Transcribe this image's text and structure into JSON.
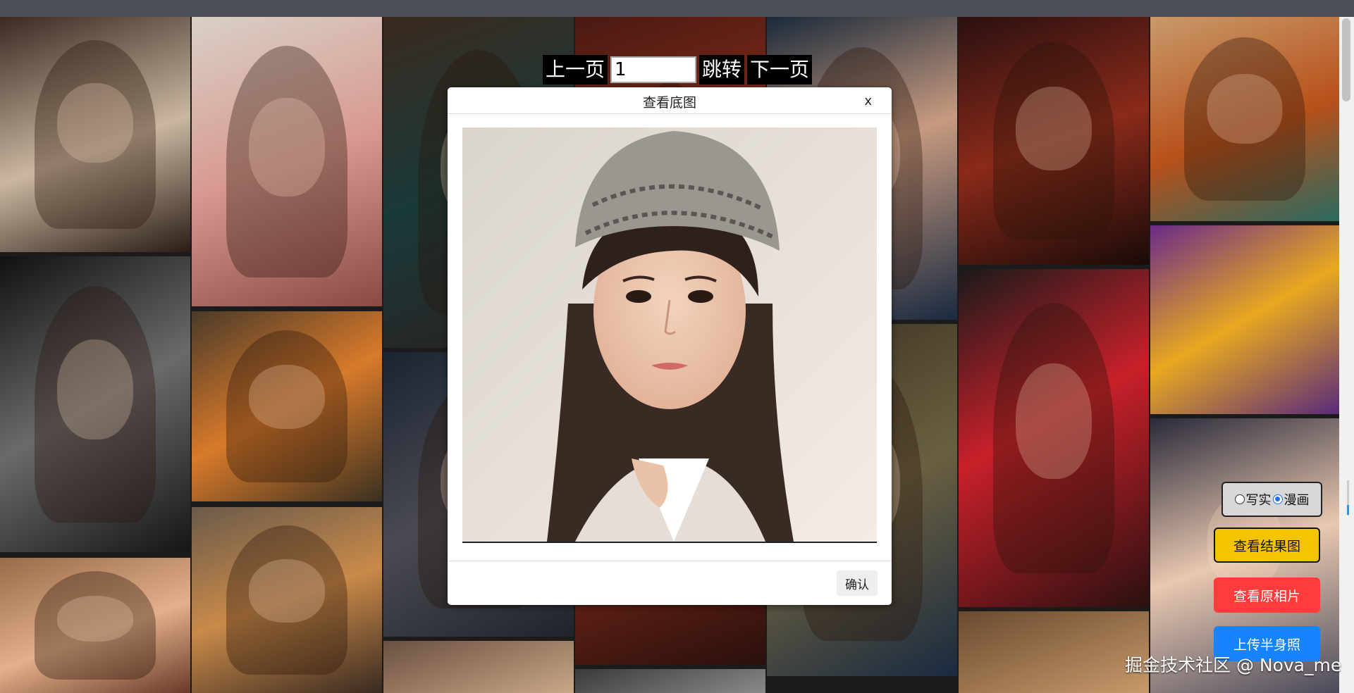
{
  "pager": {
    "prev_label": "上一页",
    "page_value": "1",
    "jump_label": "跳转",
    "next_label": "下一页"
  },
  "modal": {
    "title": "查看底图",
    "close_label": "x",
    "confirm_label": "确认"
  },
  "style_toggle": {
    "option_realistic": "写实",
    "option_comic": "漫画",
    "selected": "漫画"
  },
  "side_buttons": {
    "view_result": "查看结果图",
    "view_original": "查看原相片",
    "upload": "上传半身照"
  },
  "watermark": "掘金技术社区 @ Nova_me",
  "colors": {
    "result_button": "#f5c400",
    "original_button": "#ff3b3b",
    "upload_button": "#1683ff",
    "radio_selected": "#1a73e8"
  }
}
